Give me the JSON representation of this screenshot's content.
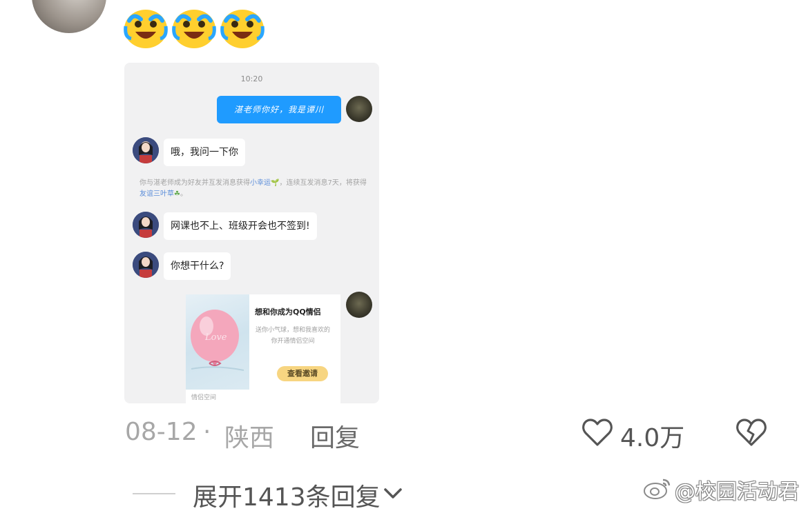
{
  "comment": {
    "emojis": [
      "crying-laughing-emoji",
      "crying-laughing-emoji",
      "crying-laughing-emoji"
    ],
    "screenshot": {
      "time": "10:20",
      "messages": [
        {
          "from": "self",
          "text": "湛老师你好，我是谭川"
        },
        {
          "from": "teacher",
          "text": "哦，我问一下你"
        },
        {
          "from": "teacher",
          "text": "网课也不上、班级开会也不签到!"
        },
        {
          "from": "teacher",
          "text": "你想干什么?"
        }
      ],
      "system_notice": {
        "part1": "你与湛老师成为好友并互发消息获得",
        "part2": "小幸运",
        "part3": "，连续互发消息7天，将获得",
        "part4": "友谊三叶草",
        "part5": "。"
      },
      "card": {
        "title": "想和你成为QQ情侣",
        "description": "送你小气球，想和我喜欢的你开通情侣空间",
        "button": "查看邀请",
        "footer": "情侣空间",
        "balloon_text": "Love"
      }
    },
    "date": "08-12",
    "separator": "·",
    "location": "陕西",
    "reply_label": "回复",
    "likes": "4.0万",
    "expand_label": "展开1413条回复",
    "watermark": "@校园活动君"
  },
  "colors": {
    "bubble_blue": "#1f9bff",
    "button_yellow": "#f7d581",
    "meta_gray": "#a7a7a7"
  },
  "icons": [
    "heart-icon",
    "broken-heart-icon",
    "chevron-down-icon",
    "weibo-logo-icon"
  ]
}
